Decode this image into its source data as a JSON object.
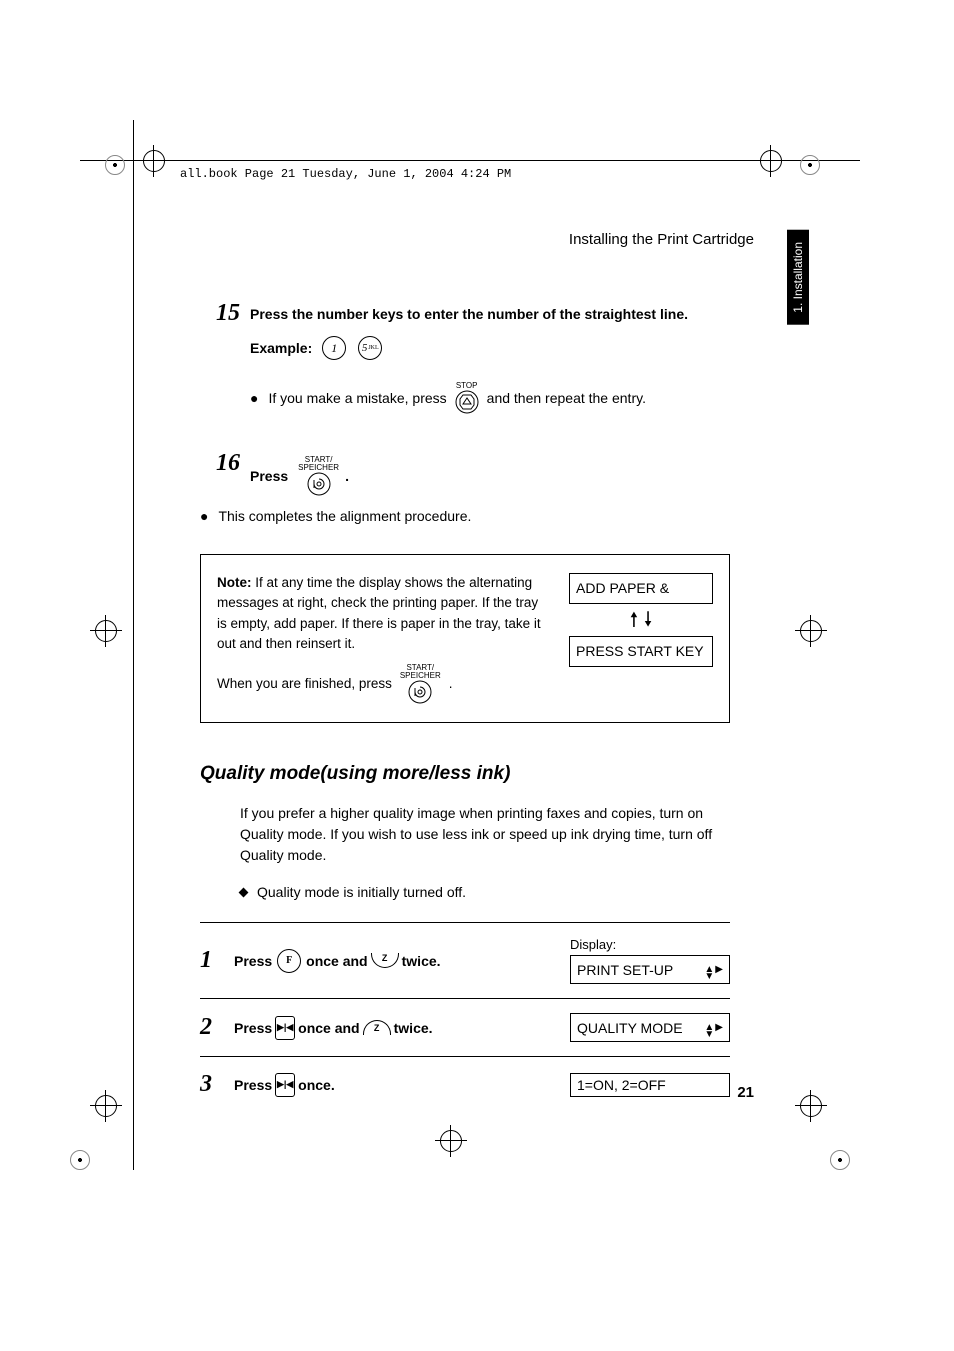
{
  "header_line": "all.book  Page 21  Tuesday, June 1, 2004  4:24 PM",
  "section_title": "Installing the Print Cartridge",
  "side_tab": "1. Installation",
  "step15": {
    "num": "15",
    "text": "Press the number keys to enter the number of the straightest line.",
    "example_label": "Example:",
    "key1": "1",
    "key2": "5",
    "key2_sub": "JKL",
    "bullet_prefix": "If you make a mistake, press",
    "stop_label": "STOP",
    "bullet_suffix": "and then repeat the entry."
  },
  "step16": {
    "num": "16",
    "press": "Press",
    "start_label_line1": "START/",
    "start_label_line2": "SPEICHER",
    "bullet": "This completes the alignment procedure."
  },
  "note": {
    "label": "Note:",
    "body": "If at any time the display shows the alternating messages at right, check the printing paper. If the tray is empty, add paper. If there is paper in the tray, take it out and then reinsert it.",
    "finish_prefix": "When you are finished, press",
    "start_label_line1": "START/",
    "start_label_line2": "SPEICHER",
    "disp1": "ADD PAPER &",
    "disp2": "PRESS START KEY"
  },
  "subheading": "Quality mode(using more/less ink)",
  "quality_para": "If you prefer a higher quality image when printing faxes and copies, turn on Quality mode. If you wish to use less ink or speed up ink drying time, turn off Quality mode.",
  "quality_bullet": "Quality mode is initially turned off.",
  "proc": [
    {
      "num": "1",
      "press": "Press",
      "key_letter": "F",
      "mid": "once and",
      "arc_label": "Z",
      "tail": "twice.",
      "display_label": "Display:",
      "display_value": "PRINT SET-UP"
    },
    {
      "num": "2",
      "press": "Press",
      "sq": "▶|◀",
      "mid": "once and",
      "arc_label": "Z",
      "tail": "twice.",
      "display_value": "QUALITY MODE"
    },
    {
      "num": "3",
      "press": "Press",
      "sq": "▶|◀",
      "tail": "once.",
      "display_value": "1=ON, 2=OFF"
    }
  ],
  "page_number": "21"
}
